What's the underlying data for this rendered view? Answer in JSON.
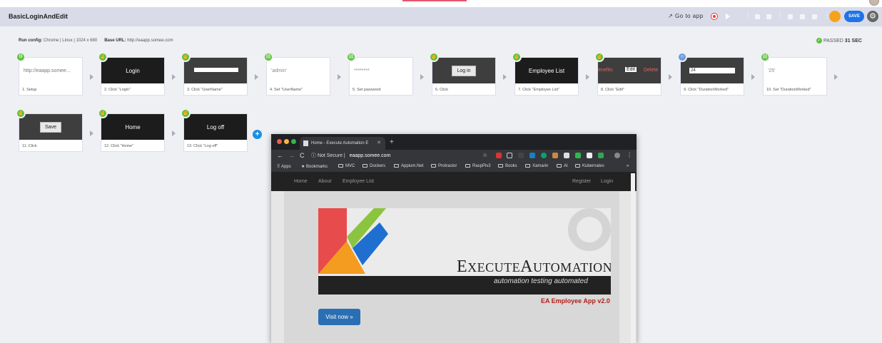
{
  "app": {
    "title": "BasicLoginAndEdit"
  },
  "toolbar": {
    "goto_label": "Go to app",
    "save_label": "SAVE"
  },
  "run": {
    "config_label": "Run config:",
    "config_value": "Chrome | Linux | 1024 x 680",
    "base_url_label": "Base URL:",
    "base_url_value": "http://eaapp.somee.com",
    "status": "PASSED",
    "duration": "31 SEC"
  },
  "steps": [
    {
      "caption": "1. Setup",
      "thumb": "http://eaapp.somee...",
      "icon": "gear-icon"
    },
    {
      "caption": "2. Click \"Login\"",
      "thumb": "Login",
      "icon": "pointer-icon"
    },
    {
      "caption": "3. Click \"UserName\"",
      "thumb": "",
      "icon": "pointer-icon"
    },
    {
      "caption": "4. Set \"UserName\"",
      "thumb": "'admin'",
      "icon": "keyboard-icon"
    },
    {
      "caption": "5. Set password",
      "thumb": "********",
      "icon": "keyboard-icon"
    },
    {
      "caption": "6. Click",
      "thumb": "Log in",
      "icon": "pointer-icon"
    },
    {
      "caption": "7. Click \"Employee List\"",
      "thumb": "Employee List",
      "icon": "pointer-icon"
    },
    {
      "caption": "8. Click \"Edit\"",
      "thumb": "Edit",
      "icon": "pointer-icon"
    },
    {
      "caption": "9. Click \"DurationWorked\"",
      "thumb": "24",
      "icon": "robot-icon"
    },
    {
      "caption": "10. Set \"DurationWorked\"",
      "thumb": "'25'",
      "icon": "keyboard-icon"
    },
    {
      "caption": "11. Click",
      "thumb": "Save",
      "icon": "pointer-icon"
    },
    {
      "caption": "12. Click \"Home\"",
      "thumb": "Home",
      "icon": "pointer-icon"
    },
    {
      "caption": "13. Click \"Log off\"",
      "thumb": "Log off",
      "icon": "pointer-icon"
    }
  ],
  "step8_extra": {
    "left": "enefits",
    "right": "Delete"
  },
  "browser": {
    "tab_title": "Home - Execute Automation E",
    "not_secure": "Not Secure",
    "domain": "eaapp.somee.com",
    "bookmarks": [
      "Apps",
      "Bookmarks",
      "MVC",
      "Dockers",
      "Appium.Net",
      "Protractor",
      "RaspPiv2",
      "Books",
      "Xamarin",
      "AI",
      "Kubernates"
    ],
    "more": "»",
    "nav": {
      "home": "Home",
      "about": "About",
      "employee_list": "Employee List",
      "register": "Register",
      "login": "Login"
    },
    "logo_brand_1": "E",
    "logo_brand_2": "XECUTE",
    "logo_brand_3": "A",
    "logo_brand_4": "UTOMATION",
    "logo_tagline": "automation testing automated",
    "app_version": "EA Employee App v2.0",
    "visit_label": "Visit now »"
  }
}
